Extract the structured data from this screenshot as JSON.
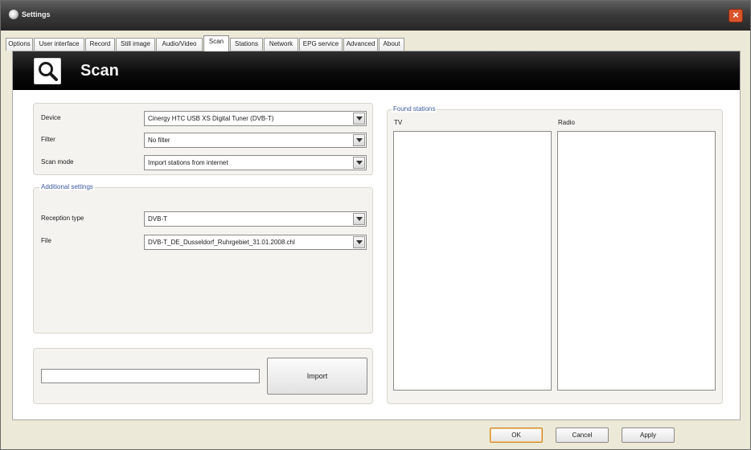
{
  "window": {
    "title": "Settings",
    "close_symbol": "×"
  },
  "tabs": [
    {
      "label": "Options",
      "active": false
    },
    {
      "label": "User interface",
      "active": false
    },
    {
      "label": "Record",
      "active": false
    },
    {
      "label": "Still image",
      "active": false
    },
    {
      "label": "Audio/Video",
      "active": false
    },
    {
      "label": "Scan",
      "active": true
    },
    {
      "label": "Stations",
      "active": false
    },
    {
      "label": "Network",
      "active": false
    },
    {
      "label": "EPG service",
      "active": false
    },
    {
      "label": "Advanced",
      "active": false
    },
    {
      "label": "About",
      "active": false
    }
  ],
  "banner": {
    "title": "Scan",
    "icon": "search-icon"
  },
  "scan": {
    "device_label": "Device",
    "device_value": "Cinergy HTC USB XS Digital Tuner (DVB-T)",
    "filter_label": "Filter",
    "filter_value": "No filter",
    "scan_mode_label": "Scan mode",
    "scan_mode_value": "Import stations from internet"
  },
  "additional": {
    "group_label": "Additional settings",
    "reception_label": "Reception type",
    "reception_value": "DVB-T",
    "file_label": "File",
    "file_value": "DVB-T_DE_Dusseldorf_Ruhrgebiet_31.01.2008.chl"
  },
  "import": {
    "button_label": "Import",
    "progress": 0
  },
  "found": {
    "group_label": "Found stations",
    "tv_label": "TV",
    "radio_label": "Radio"
  },
  "dialog": {
    "ok_label": "OK",
    "cancel_label": "Cancel",
    "apply_label": "Apply"
  },
  "colors": {
    "title_bar": "#3b3b3b",
    "banner": "#0b0b0b",
    "group_label": "#3c5aa0",
    "close_button": "#d8542b"
  }
}
